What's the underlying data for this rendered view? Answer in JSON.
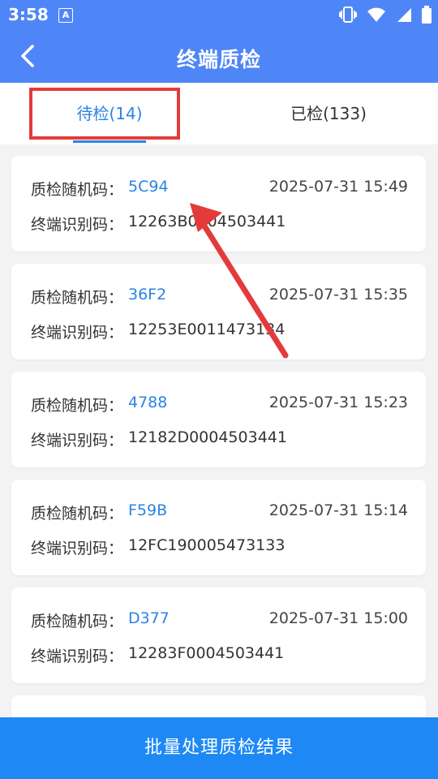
{
  "status_bar": {
    "time": "3:58"
  },
  "header": {
    "title": "终端质检"
  },
  "tabs": [
    {
      "label": "待检(14)",
      "active": true
    },
    {
      "label": "已检(133)",
      "active": false
    }
  ],
  "field_labels": {
    "random_code": "质检随机码：",
    "terminal_id": "终端识别码："
  },
  "records": [
    {
      "random_code": "5C94",
      "time": "2025-07-31 15:49",
      "terminal_id": "12263B0004503441"
    },
    {
      "random_code": "36F2",
      "time": "2025-07-31 15:35",
      "terminal_id": "12253E0011473134"
    },
    {
      "random_code": "4788",
      "time": "2025-07-31 15:23",
      "terminal_id": "12182D0004503441"
    },
    {
      "random_code": "F59B",
      "time": "2025-07-31 15:14",
      "terminal_id": "12FC190005473133"
    },
    {
      "random_code": "D377",
      "time": "2025-07-31 15:00",
      "terminal_id": "12283F0004503441"
    }
  ],
  "bottom_button": {
    "label": "批量处理质检结果"
  },
  "colors": {
    "accent": "#4f86f7",
    "link": "#2a84e6",
    "button": "#1e88f5",
    "annotation": "#e33b3b"
  }
}
